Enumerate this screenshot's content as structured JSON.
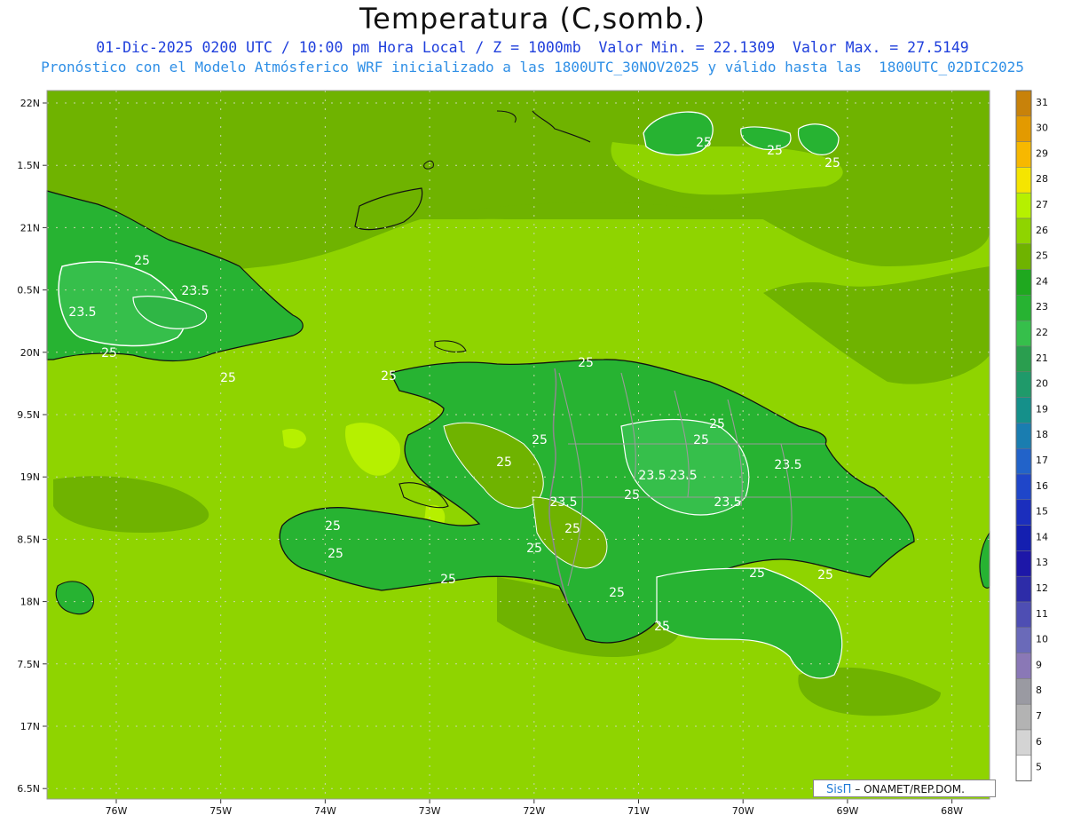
{
  "header": {
    "title": "Temperatura (C,somb.)",
    "line1": "01-Dic-2025 0200 UTC / 10:00 pm Hora Local / Z = 1000mb  Valor Min. = 22.1309  Valor Max. = 27.5149",
    "line2": "Pronóstico con el Modelo Atmósferico WRF inicializado a las 1800UTC_30NOV2025 y válido hasta las  1800UTC_02DIC2025"
  },
  "axes": {
    "lat_labels": [
      "22N",
      "1.5N",
      "21N",
      "0.5N",
      "20N",
      "9.5N",
      "19N",
      "8.5N",
      "18N",
      "7.5N",
      "17N",
      "6.5N"
    ],
    "lon_labels": [
      "76W",
      "75W",
      "74W",
      "73W",
      "72W",
      "71W",
      "70W",
      "69W",
      "68W"
    ]
  },
  "colorbar": {
    "labels": [
      "31",
      "30",
      "29",
      "28",
      "27",
      "26",
      "25",
      "24",
      "23",
      "22",
      "21",
      "20",
      "19",
      "18",
      "17",
      "16",
      "15",
      "14",
      "13",
      "12",
      "11",
      "10",
      "9",
      "8",
      "7",
      "6",
      "5"
    ],
    "colors": [
      "#c8820a",
      "#e39a00",
      "#f7b800",
      "#f5e500",
      "#b6f000",
      "#8fd400",
      "#6fb300",
      "#1fa81f",
      "#27b332",
      "#36bf4b",
      "#2a9e4f",
      "#1f9a6a",
      "#15908a",
      "#1a7db0",
      "#2263c9",
      "#1f46c9",
      "#1b2ebd",
      "#141fb0",
      "#1d17a8",
      "#2d2ca8",
      "#4e4eb3",
      "#6a6ab9",
      "#8a78b6",
      "#9a9aa2",
      "#b3b3b3",
      "#d4d4d4",
      "#ffffff"
    ]
  },
  "contour_labels": [
    "25",
    "25",
    "23.5",
    "23.5",
    "25",
    "25",
    "25",
    "25",
    "25",
    "25",
    "25",
    "23.5",
    "23.5",
    "23.5",
    "23.5",
    "25",
    "23.5",
    "25",
    "25",
    "25",
    "25",
    "25",
    "25",
    "25",
    "25",
    "25",
    "25",
    "25"
  ],
  "credit": {
    "brand": "SisΠ",
    "text": "– ONAMET/REP.DOM."
  }
}
